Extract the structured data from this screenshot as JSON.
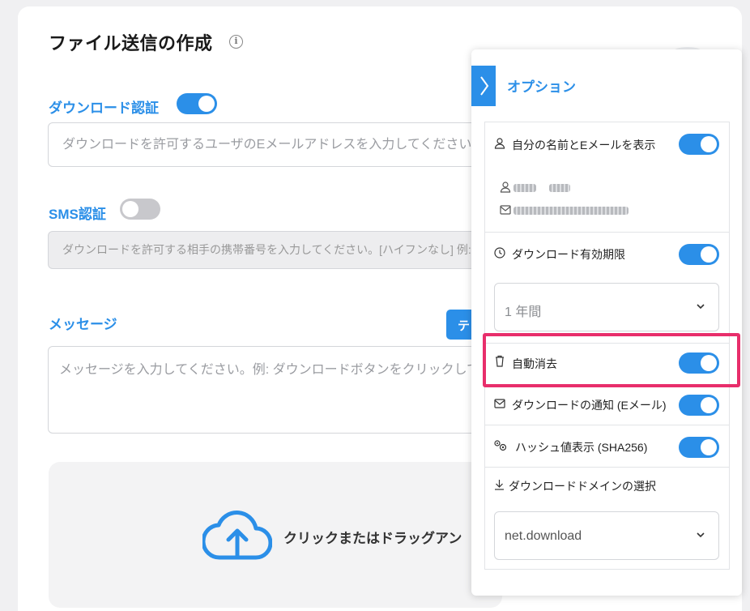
{
  "page": {
    "title": "ファイル送信の作成",
    "info_icon": "info-icon"
  },
  "download_auth": {
    "label": "ダウンロード認証",
    "enabled": true,
    "placeholder": "ダウンロードを許可するユーザのEメールアドレスを入力してください。"
  },
  "sms_auth": {
    "label": "SMS認証",
    "enabled": false,
    "placeholder": "ダウンロードを許可する相手の携帯番号を入力してください。[ハイフンなし] 例:"
  },
  "message": {
    "label": "メッセージ",
    "template_button": "テ",
    "placeholder": "メッセージを入力してください。例: ダウンロードボタンをクリックして"
  },
  "upload": {
    "icon": "cloud-upload-icon",
    "text": "クリックまたはドラッグアン"
  },
  "options_panel": {
    "title": "オプション",
    "collapse_icon": "chevron-right-icon",
    "show_name_email": {
      "label": "自分の名前とEメールを表示",
      "icon": "person-icon",
      "enabled": true
    },
    "sender": {
      "name_icon": "person-icon",
      "email_icon": "mail-icon"
    },
    "expiry": {
      "label": "ダウンロード有効期限",
      "icon": "clock-icon",
      "enabled": true,
      "selected": "1 年間"
    },
    "auto_delete": {
      "label": "自動消去",
      "icon": "trash-icon",
      "enabled": true
    },
    "download_notify": {
      "label": "ダウンロードの通知 (Eメール)",
      "icon": "mail-icon",
      "enabled": true
    },
    "hash_display": {
      "label": "ハッシュ値表示 (SHA256)",
      "icon": "gears-icon",
      "enabled": true
    },
    "domain": {
      "label": "ダウンロードドメインの選択",
      "icon": "download-arrow-icon",
      "selected": "net.download"
    }
  },
  "colors": {
    "accent": "#2b8fe8",
    "highlight": "#e82e6b",
    "toggle_off": "#c8c8cc"
  }
}
